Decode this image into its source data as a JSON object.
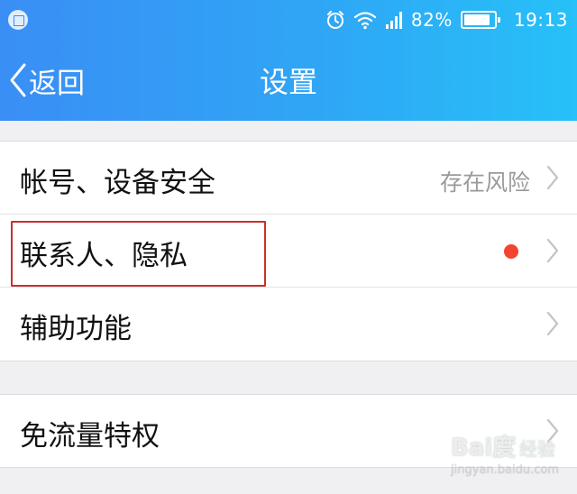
{
  "status_bar": {
    "battery": "82%",
    "time": "19:13",
    "icons": [
      "screenshot-icon",
      "alarm-icon",
      "wifi-icon",
      "signal-icon",
      "battery-icon"
    ]
  },
  "nav": {
    "back_label": "返回",
    "title": "设置"
  },
  "groups": [
    {
      "items": [
        {
          "label": "帐号、设备安全",
          "value": "存在风险",
          "badge": null
        },
        {
          "label": "联系人、隐私",
          "value": "",
          "badge": "red-dot"
        },
        {
          "label": "辅助功能",
          "value": "",
          "badge": null
        }
      ]
    },
    {
      "items": [
        {
          "label": "免流量特权",
          "value": "",
          "badge": null
        }
      ]
    }
  ],
  "colors": {
    "header_start": "#3a8ef5",
    "header_end": "#27c0f8",
    "badge_red": "#f4432f",
    "highlight": "#c9302c"
  },
  "watermark": {
    "logo": "Bai度",
    "text": "经验",
    "url": "jingyan.baidu.com"
  }
}
